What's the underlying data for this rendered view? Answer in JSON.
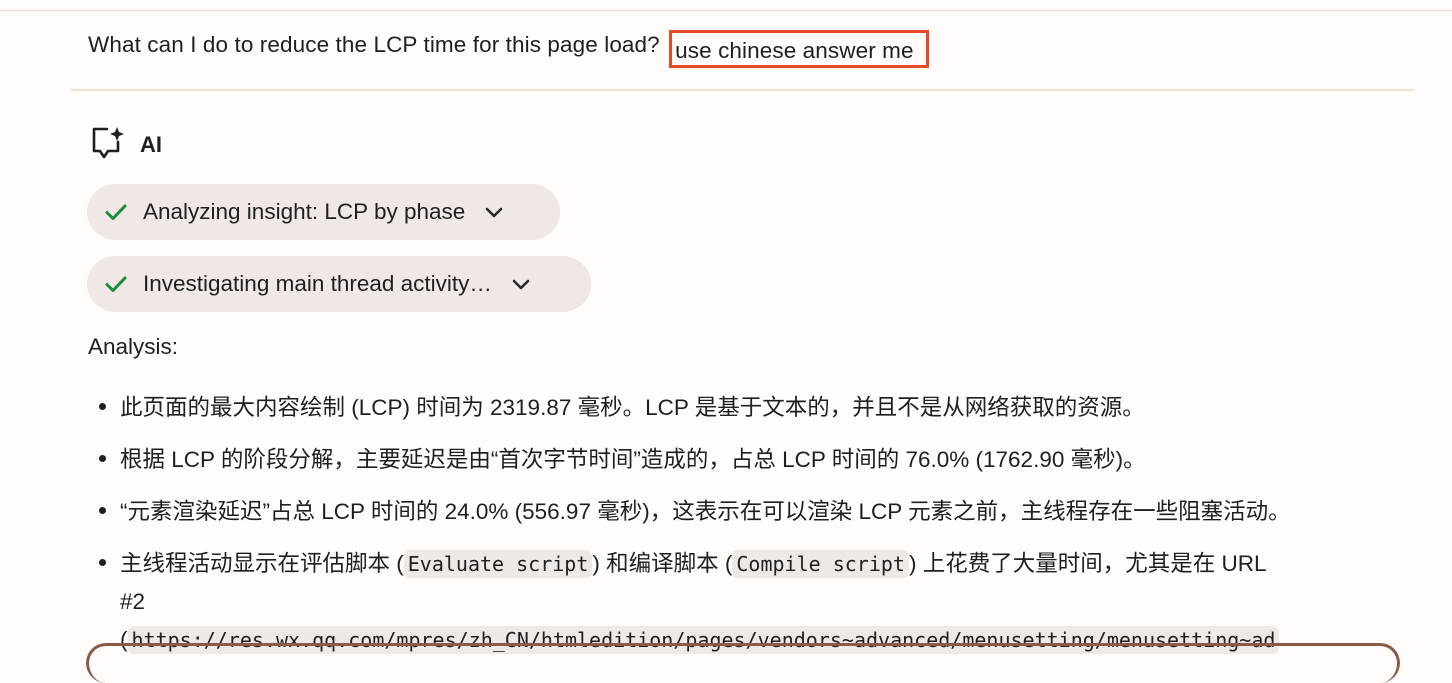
{
  "prompt": {
    "text": "What can I do to reduce the LCP time for this page load?",
    "highlighted": "use chinese answer me"
  },
  "ai_header": {
    "label": "AI",
    "icon": "ai-sparkle-chat-icon"
  },
  "steps": [
    {
      "label": "Analyzing insight: LCP by phase",
      "status": "done"
    },
    {
      "label": "Investigating main thread activity…",
      "status": "done"
    }
  ],
  "analysis": {
    "heading": "Analysis:",
    "bullets": [
      "此页面的最大内容绘制 (LCP) 时间为 2319.87 毫秒。LCP 是基于文本的，并且不是从网络获取的资源。",
      "根据 LCP 的阶段分解，主要延迟是由“首次字节时间”造成的，占总 LCP 时间的 76.0% (1762.90 毫秒)。",
      "“元素渲染延迟”占总 LCP 时间的 24.0% (556.97 毫秒)，这表示在可以渲染 LCP 元素之前，主线程存在一些阻塞活动。"
    ],
    "bullet4": {
      "before": "主线程活动显示在评估脚本 (",
      "code1": "Evaluate script",
      "mid": ") 和编译脚本 (",
      "code2": "Compile script",
      "after": ") 上花费了大量时间，尤其是在 URL",
      "line2": "#2",
      "line3_prefix": "(",
      "url": "https://res.wx.qq.com/mpres/zh_CN/htmledition/pages/vendors~advanced/menusetting/menusetting~ad"
    }
  },
  "colors": {
    "highlight_border": "#e6482c",
    "pill_bg": "#f0e8e4",
    "check_green": "#1a8a3c",
    "divider": "#f8e1d2"
  }
}
